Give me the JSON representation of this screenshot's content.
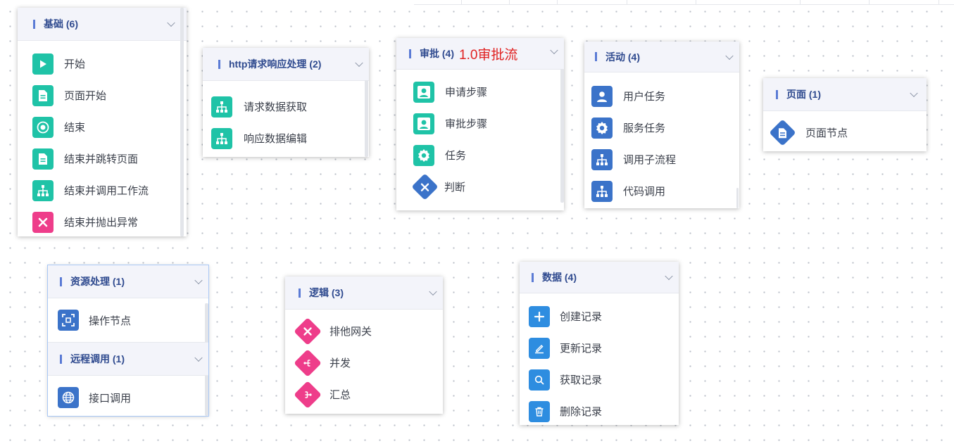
{
  "panels": {
    "basic": {
      "title": "基础 (6)",
      "items": [
        "开始",
        "页面开始",
        "结束",
        "结束并跳转页面",
        "结束并调用工作流",
        "结束并抛出异常"
      ]
    },
    "http": {
      "title": "http请求响应处理 (2)",
      "items": [
        "请求数据获取",
        "响应数据编辑"
      ]
    },
    "approval": {
      "title": "审批 (4)",
      "annotation": "1.0审批流",
      "items": [
        "申请步骤",
        "审批步骤",
        "任务",
        "判断"
      ]
    },
    "activity": {
      "title": "活动 (4)",
      "items": [
        "用户任务",
        "服务任务",
        "调用子流程",
        "代码调用"
      ]
    },
    "page": {
      "title": "页面 (1)",
      "items": [
        "页面节点"
      ]
    },
    "resource": {
      "title": "资源处理 (1)",
      "items": [
        "操作节点"
      ]
    },
    "remote": {
      "title": "远程调用 (1)",
      "items": [
        "接口调用"
      ]
    },
    "logic": {
      "title": "逻辑 (3)",
      "items": [
        "排他网关",
        "并发",
        "汇总"
      ]
    },
    "data": {
      "title": "数据 (4)",
      "items": [
        "创建记录",
        "更新记录",
        "获取记录",
        "删除记录"
      ]
    }
  },
  "colors": {
    "teal": "#1fc3a7",
    "pink": "#ee3d8a",
    "blue": "#3b73c9",
    "light_blue": "#2e8de0",
    "title": "#2f4a8f",
    "annotation": "#e02020"
  }
}
